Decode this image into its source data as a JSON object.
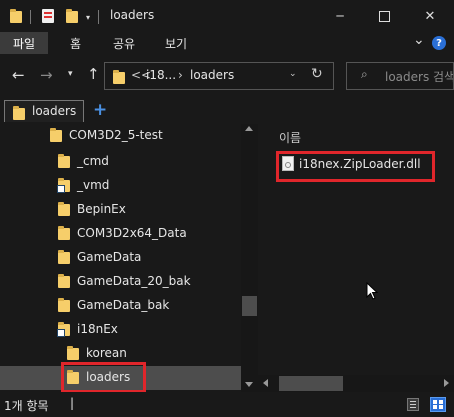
{
  "window": {
    "title": "loaders",
    "min_symbol": "─",
    "max_symbol": "☐",
    "close_symbol": "✕"
  },
  "ribbon": {
    "tabs": [
      "파일",
      "홈",
      "공유",
      "보기"
    ],
    "chevron": "⌄",
    "help": "?"
  },
  "address_bar": {
    "crumbs": [
      "<<",
      "i18...",
      "›",
      "loaders"
    ],
    "search_placeholder": "loaders 검색"
  },
  "tabs_row": {
    "active_tab": "loaders",
    "add_tab_symbol": "+"
  },
  "tree": {
    "items": [
      {
        "label": "COM3D2_5-test",
        "indent": 1
      },
      {
        "label": "_cmd",
        "indent": 2
      },
      {
        "label": "_vmd",
        "indent": 2,
        "shortcut": true
      },
      {
        "label": "BepinEx",
        "indent": 2
      },
      {
        "label": "COM3D2x64_Data",
        "indent": 2
      },
      {
        "label": "GameData",
        "indent": 2
      },
      {
        "label": "GameData_20_bak",
        "indent": 2
      },
      {
        "label": "GameData_bak",
        "indent": 2
      },
      {
        "label": "i18nEx",
        "indent": 2,
        "shortcut": true
      },
      {
        "label": "korean",
        "indent": 3
      },
      {
        "label": "loaders",
        "indent": 3,
        "selected": true
      }
    ]
  },
  "content": {
    "column_header": "이름",
    "files": [
      {
        "name": "i18nex.ZipLoader.dll"
      }
    ]
  },
  "status_bar": {
    "item_count": "1개 항목",
    "separator": "|"
  },
  "colors": {
    "background": "#191919",
    "folder": "#f6ce6a",
    "highlight": "#e0262b",
    "selected": "#4d4d4d"
  }
}
